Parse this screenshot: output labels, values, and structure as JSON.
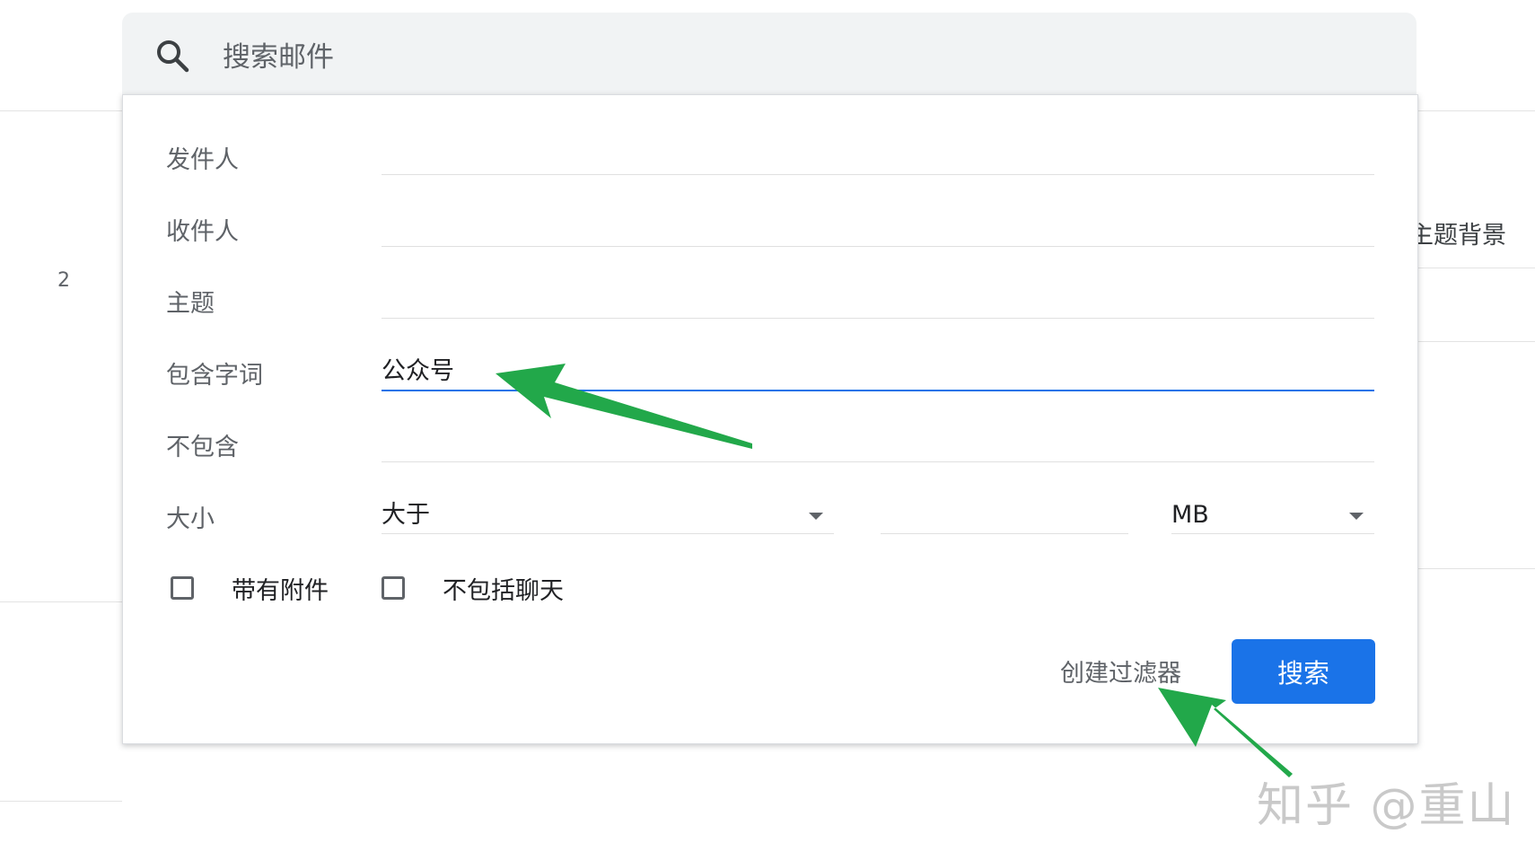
{
  "background": {
    "row_number": "2",
    "partial_text": "主题背景"
  },
  "search": {
    "placeholder": "搜索邮件"
  },
  "form": {
    "from_label": "发件人",
    "to_label": "收件人",
    "subject_label": "主题",
    "has_words_label": "包含字词",
    "has_words_value": "公众号",
    "doesnt_have_label": "不包含",
    "size_label": "大小",
    "size_operator": "大于",
    "size_value": "",
    "size_unit": "MB",
    "has_attachment_label": "带有附件",
    "exclude_chats_label": "不包括聊天",
    "create_filter_label": "创建过滤器",
    "search_button_label": "搜索"
  },
  "watermark": "知乎 @重山",
  "colors": {
    "accent": "#1a73e8",
    "annotation_arrow": "#22a84a"
  }
}
